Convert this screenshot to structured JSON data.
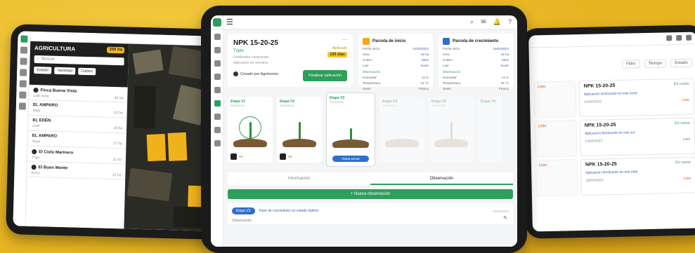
{
  "left_tablet": {
    "panel_title": "AGRICULTURA",
    "panel_badge": "355 ha",
    "search_placeholder": "Buscar",
    "filters": [
      "Estado",
      "Variedad",
      "Cultivo"
    ],
    "items": [
      {
        "title": "Finca Buena Vista",
        "meta": "Lote norte",
        "value": "45 ha"
      },
      {
        "title": "EL AMPARO",
        "meta": "Maíz",
        "value": "32 ha"
      },
      {
        "title": "EL EDÉN",
        "meta": "Café",
        "value": "18 ha"
      },
      {
        "title": "EL AMPARO",
        "meta": "Soya",
        "value": "27 ha"
      },
      {
        "title": "El Cielo Marinero",
        "meta": "Trigo",
        "value": "21 ha"
      },
      {
        "title": "El Buen Monte",
        "meta": "Arroz",
        "value": "12 ha"
      }
    ]
  },
  "center_tablet": {
    "menu_icon": "☰",
    "top_icons": [
      "search-icon",
      "message-icon",
      "bell-icon",
      "help-icon"
    ],
    "product": {
      "name": "NPK 15-20-25",
      "type": "Triple",
      "desc_line1": "Fertilizante compuesto",
      "desc_line2": "Aplicación en siembra",
      "status_label": "Aplicado",
      "status_value": "105 días",
      "author": "Creado por Agrónomo",
      "button": "Finalizar aplicación"
    },
    "info_cards": [
      {
        "title": "Parcela de inicio",
        "rows": [
          [
            "Fecha inicio",
            "01/03/2023"
          ],
          [
            "Área",
            "15 ha"
          ],
          [
            "Cultivo",
            "Maíz"
          ],
          [
            "Lote",
            "Norte"
          ]
        ],
        "sub": "Observación",
        "rows2": [
          [
            "Humedad",
            "12 %"
          ],
          [
            "Temperatura",
            "24 °C"
          ],
          [
            "Suelo",
            "Franco"
          ]
        ]
      },
      {
        "title": "Parcela de crecimiento",
        "rows": [
          [
            "Fecha inicio",
            "15/04/2023"
          ],
          [
            "Área",
            "15 ha"
          ],
          [
            "Cultivo",
            "Maíz"
          ],
          [
            "Lote",
            "Norte"
          ]
        ],
        "sub": "Observación",
        "rows2": [
          [
            "Humedad",
            "14 %"
          ],
          [
            "Temperatura",
            "26 °C"
          ],
          [
            "Suelo",
            "Franco"
          ]
        ]
      }
    ],
    "stages": [
      {
        "label": "Etapa V1",
        "date": "01/03/2023",
        "thumb": "V1"
      },
      {
        "label": "Etapa V2",
        "date": "15/03/2023",
        "thumb": "V2"
      },
      {
        "label": "Etapa V3",
        "date": "01/04/2023",
        "pill": "Etapa actual"
      },
      {
        "label": "Etapa V4",
        "date": "15/04/2023"
      },
      {
        "label": "Etapa V5",
        "date": "01/05/2023"
      },
      {
        "label": "Etapa V6",
        "date": "15/05/2023"
      }
    ],
    "tabs": [
      "Información",
      "Observación"
    ],
    "add_button": "+ Nueva observación",
    "observation": {
      "tag": "Etapa V3",
      "text": "Fase de crecimiento en estado óptimo",
      "date": "02/04/2023",
      "author": "Observación"
    }
  },
  "right_tablet": {
    "sort_options": [
      "Filtro",
      "Tiempo",
      "Estado"
    ],
    "cards": [
      {
        "mini": "Listo",
        "title": "NPK 15-20-25",
        "status": "En curso",
        "link": "Aplicación fertilizante en lote norte",
        "date": "12/04/2023",
        "pill": "Listo"
      },
      {
        "mini": "Listo",
        "title": "NPK 15-20-25",
        "status": "En curso",
        "link": "Aplicación fertilizante en lote sur",
        "date": "14/04/2023",
        "pill": "Listo"
      },
      {
        "mini": "Listo",
        "title": "NPK 15-20-25",
        "status": "En curso",
        "link": "Aplicación fertilizante en lote este",
        "date": "18/04/2023",
        "pill": "Listo"
      }
    ]
  },
  "colors": {
    "background": "#e7b422",
    "brand_green": "#2e9e5b",
    "accent_blue": "#2f6fc9",
    "accent_orange": "#f0a91c"
  }
}
